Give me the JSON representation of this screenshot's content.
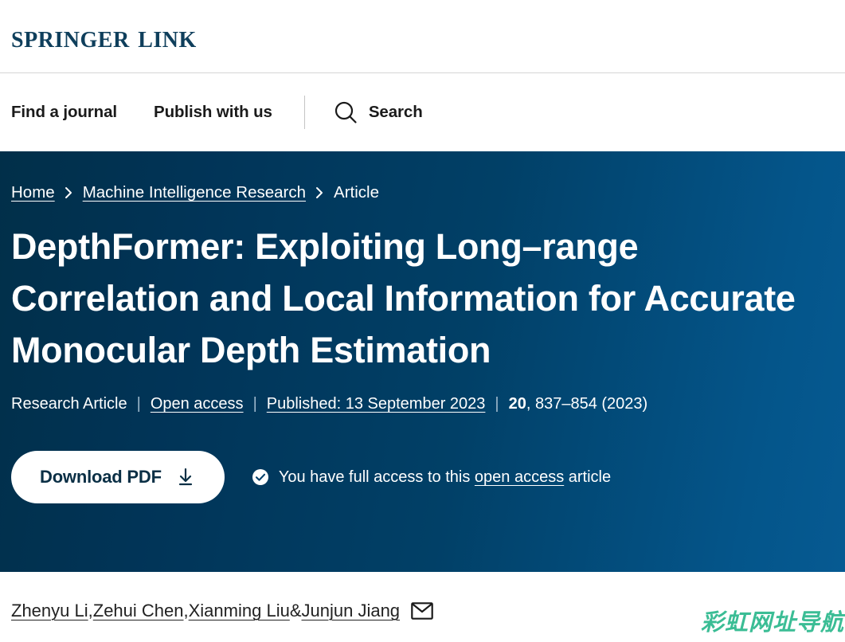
{
  "brand": {
    "logo_text": "Springer Link"
  },
  "nav": {
    "items": [
      {
        "label": "Find a journal"
      },
      {
        "label": "Publish with us"
      }
    ],
    "search_label": "Search",
    "search_icon": "search-icon"
  },
  "breadcrumb": {
    "items": [
      {
        "label": "Home",
        "link": true
      },
      {
        "label": "Machine Intelligence Research",
        "link": true
      },
      {
        "label": "Article",
        "link": false
      }
    ],
    "separator": "›"
  },
  "article": {
    "title": "DepthFormer: Exploiting Long–range Correlation and Local Information for Accurate Monocular Depth Estimation",
    "meta": {
      "type": "Research Article",
      "access": "Open access",
      "published": "Published: 13 September 2023",
      "volume": "20",
      "pages": ", 837–854 (2023)",
      "separator": "|"
    },
    "download_label": "Download PDF",
    "download_icon": "download-icon",
    "access_icon": "check-circle-icon",
    "access_note_before": "You have full access to this ",
    "access_note_link": "open access",
    "access_note_after": " article",
    "authors": [
      {
        "name": "Zhenyu Li",
        "link": true
      },
      {
        "name": ", ",
        "link": false
      },
      {
        "name": "Zehui Chen",
        "link": true
      },
      {
        "name": ", ",
        "link": false
      },
      {
        "name": "Xianming Liu",
        "link": true
      },
      {
        "name": " & ",
        "link": false
      },
      {
        "name": "Junjun Jiang",
        "link": true
      }
    ],
    "contact_icon": "envelope-icon"
  },
  "watermark": {
    "text": "彩虹网址导航",
    "color": "#3bbd95"
  },
  "colors": {
    "hero_start": "#012f49",
    "hero_end": "#065a92",
    "logo": "#0f3f5c",
    "nav_text": "#1a1a1a"
  }
}
